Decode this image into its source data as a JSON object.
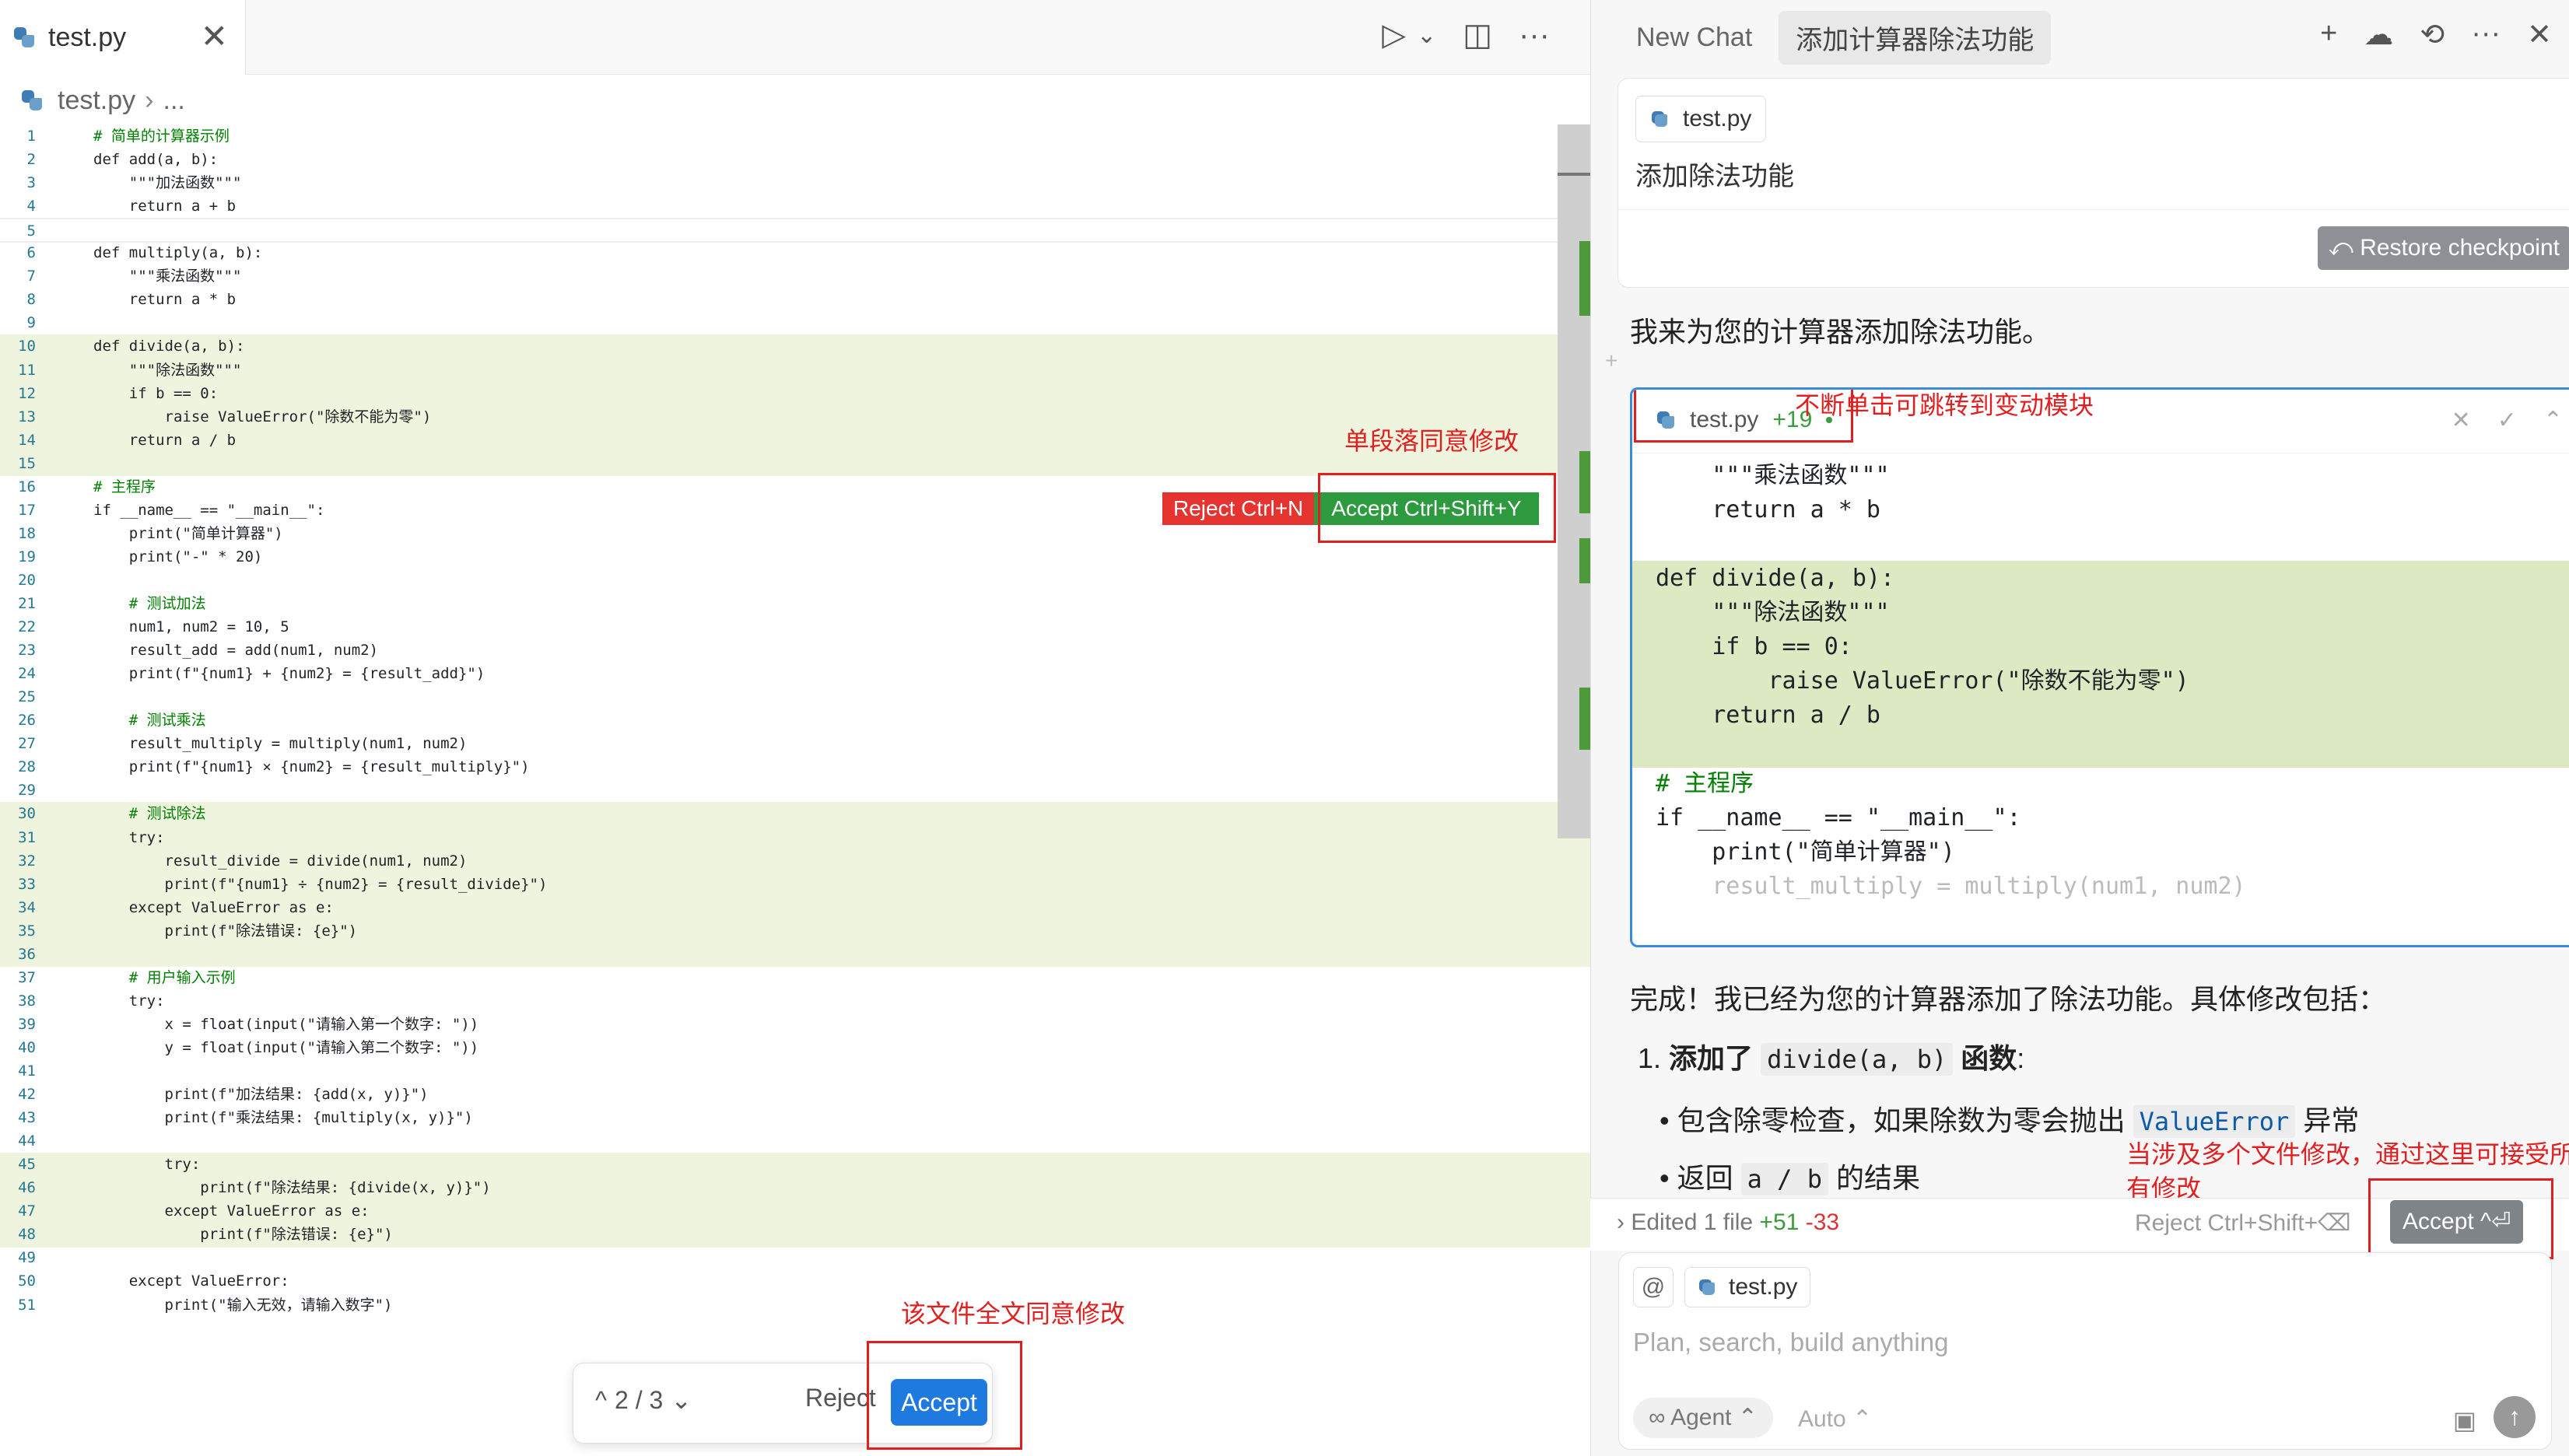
{
  "editor": {
    "tab_label": "test.py",
    "close_glyph": "✕",
    "actions": {
      "run": "▷",
      "run_menu": "⌄",
      "split": "◫",
      "more": "···"
    },
    "breadcrumb": {
      "file": "test.py",
      "sep": "›",
      "more": "..."
    },
    "lines": [
      "# 简单的计算器示例",
      "def add(a, b):",
      "    \"\"\"加法函数\"\"\"",
      "    return a + b",
      "",
      "def multiply(a, b):",
      "    \"\"\"乘法函数\"\"\"",
      "    return a * b",
      "",
      "def divide(a, b):",
      "    \"\"\"除法函数\"\"\"",
      "    if b == 0:",
      "        raise ValueError(\"除数不能为零\")",
      "    return a / b",
      "",
      "# 主程序",
      "if __name__ == \"__main__\":",
      "    print(\"简单计算器\")",
      "    print(\"-\" * 20)",
      "",
      "    # 测试加法",
      "    num1, num2 = 10, 5",
      "    result_add = add(num1, num2)",
      "    print(f\"{num1} + {num2} = {result_add}\")",
      "",
      "    # 测试乘法",
      "    result_multiply = multiply(num1, num2)",
      "    print(f\"{num1} × {num2} = {result_multiply}\")",
      "",
      "    # 测试除法",
      "    try:",
      "        result_divide = divide(num1, num2)",
      "        print(f\"{num1} ÷ {num2} = {result_divide}\")",
      "    except ValueError as e:",
      "        print(f\"除法错误: {e}\")",
      "",
      "    # 用户输入示例",
      "    try:",
      "        x = float(input(\"请输入第一个数字: \"))",
      "        y = float(input(\"请输入第二个数字: \"))",
      "",
      "        print(f\"加法结果: {add(x, y)}\")",
      "        print(f\"乘法结果: {multiply(x, y)}\")",
      "",
      "        try:",
      "            print(f\"除法结果: {divide(x, y)}\")",
      "        except ValueError as e:",
      "            print(f\"除法错误: {e}\")",
      "",
      "    except ValueError:",
      "        print(\"输入无效，请输入数字\")"
    ],
    "inline_reject": "Reject Ctrl+N",
    "inline_accept": "Accept Ctrl+Shift+Y",
    "pager": {
      "prev": "^",
      "text": "2 / 3",
      "next": "⌄"
    },
    "bottom_reject": "Reject",
    "bottom_accept": "Accept"
  },
  "annotations": {
    "hunk_accept": "单段落同意修改",
    "file_accept": "该文件全文同意修改",
    "jump_hint": "不断单击可跳转到变动模块",
    "all_accept": "当涉及多个文件修改，通过这里可接受所有修改"
  },
  "chat": {
    "tabs": [
      "New Chat",
      "添加计算器除法功能"
    ],
    "actions": {
      "new": "+",
      "cloud": "☁",
      "history": "⟲",
      "more": "···",
      "close": "✕"
    },
    "user_msg": {
      "file_chip": "test.py",
      "text": "添加除法功能",
      "restore": "Restore checkpoint",
      "restore_icon": "⤺"
    },
    "intro": "我来为您的计算器添加除法功能。",
    "diff": {
      "file": "test.py",
      "added": "+19",
      "controls": {
        "reject": "✕",
        "accept": "✓",
        "nav": "⌃"
      },
      "lines": [
        "    \"\"\"乘法函数\"\"\"",
        "    return a * b",
        "",
        "def divide(a, b):",
        "    \"\"\"除法函数\"\"\"",
        "    if b == 0:",
        "        raise ValueError(\"除数不能为零\")",
        "    return a / b",
        "",
        "# 主程序",
        "if __name__ == \"__main__\":",
        "    print(\"简单计算器\")",
        "    result_multiply = multiply(num1, num2)"
      ]
    },
    "done": "完成！我已经为您的计算器添加了除法功能。具体修改包括：",
    "item1_prefix": "1.",
    "item1_a": "添加了",
    "item1_code": "divide(a, b)",
    "item1_b": "函数",
    "item1_colon": ":",
    "b1_a": "包含除零检查，如果除数为零会抛出",
    "b1_code": "ValueError",
    "b1_b": "异常",
    "b2_a": "返回",
    "b2_code": "a / b",
    "b2_b": "的结果",
    "edited": {
      "chevron": "›",
      "label": "Edited 1 file",
      "plus": "+51",
      "minus": "-33",
      "reject": "Reject Ctrl+Shift+⌫",
      "accept": "Accept ^⏎"
    },
    "input": {
      "at": "@",
      "chip": "test.py",
      "placeholder": "Plan, search, build anything",
      "agent": "∞ Agent ⌃",
      "auto": "Auto ⌃",
      "image_icon": "▣",
      "send_icon": "↑"
    }
  }
}
